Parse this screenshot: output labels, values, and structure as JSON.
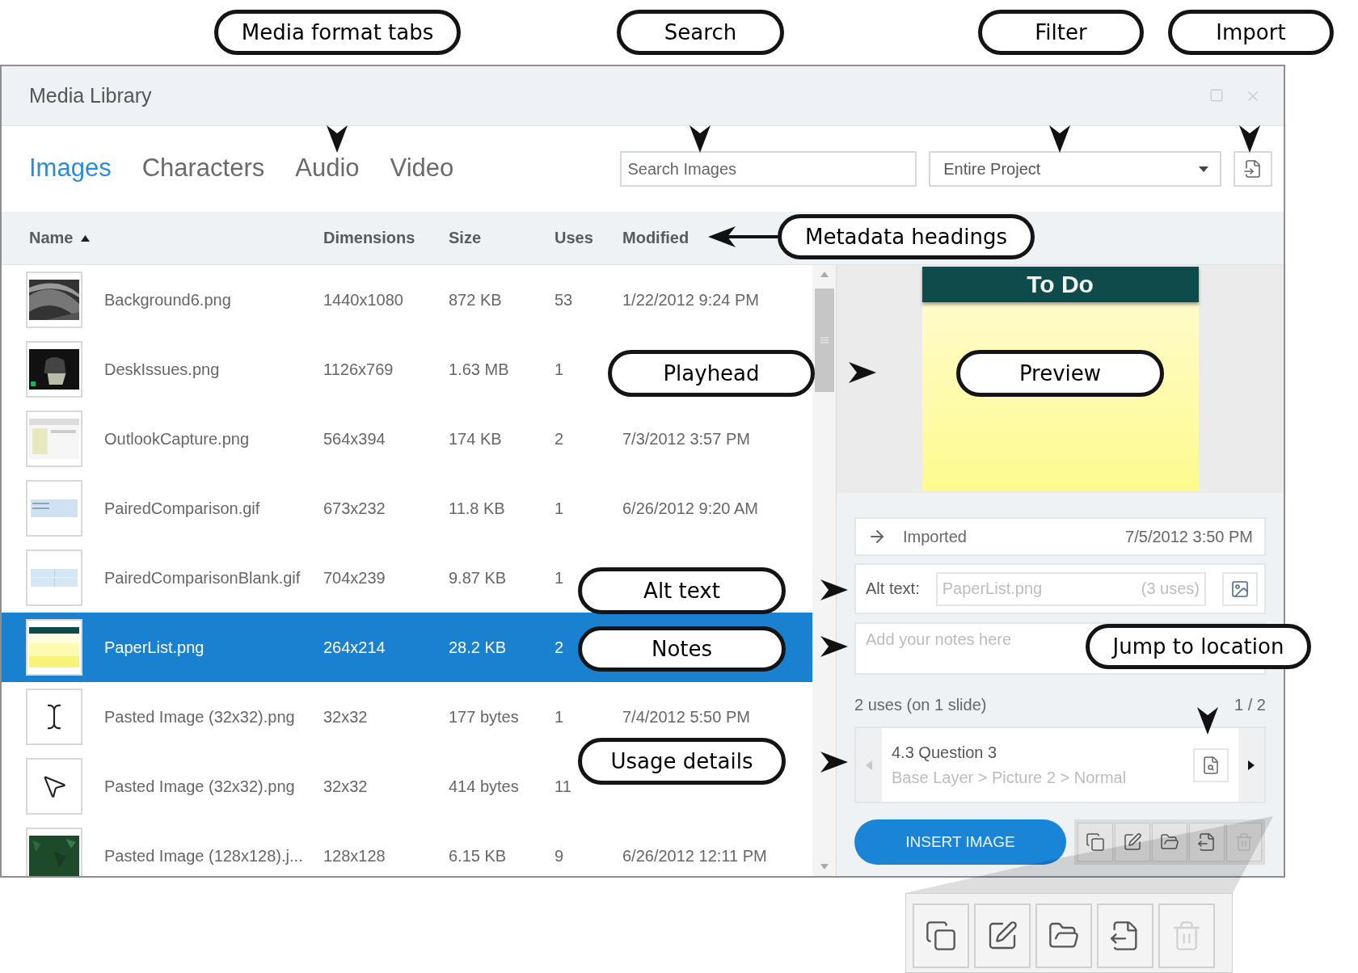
{
  "callouts": [
    {
      "text": "Media format tabs"
    },
    {
      "text": "Search"
    },
    {
      "text": "Filter"
    },
    {
      "text": "Import"
    },
    {
      "text": "Metadata headings"
    },
    {
      "text": "Playhead"
    },
    {
      "text": "Preview"
    },
    {
      "text": "Alt text"
    },
    {
      "text": "Notes"
    },
    {
      "text": "Jump to location"
    },
    {
      "text": "Usage details"
    }
  ],
  "window": {
    "title": "Media Library"
  },
  "tabs": [
    {
      "label": "Images",
      "selected": true
    },
    {
      "label": "Characters",
      "selected": false
    },
    {
      "label": "Audio",
      "selected": false
    },
    {
      "label": "Video",
      "selected": false
    }
  ],
  "search": {
    "placeholder": "Search Images"
  },
  "filter": {
    "value": "Entire Project"
  },
  "table": {
    "columns": [
      {
        "label": "Name",
        "sorted": true
      },
      {
        "label": "Dimensions",
        "sorted": false
      },
      {
        "label": "Size",
        "sorted": false
      },
      {
        "label": "Uses",
        "sorted": false
      },
      {
        "label": "Modified",
        "sorted": false
      }
    ],
    "rows": [
      {
        "kind": "picture",
        "name": "Background6.png",
        "dimensions": "1440x1080",
        "size": "872 KB",
        "uses": "53",
        "modified": "1/22/2012 9:24 PM",
        "selected": false
      },
      {
        "kind": "picture",
        "name": "DeskIssues.png",
        "dimensions": "1126x769",
        "size": "1.63 MB",
        "uses": "1",
        "selected": false
      },
      {
        "kind": "picture",
        "name": "OutlookCapture.png",
        "dimensions": "564x394",
        "size": "174 KB",
        "uses": "2",
        "modified": "7/3/2012 3:57 PM",
        "selected": false
      },
      {
        "kind": "picture",
        "name": "PairedComparison.gif",
        "dimensions": "673x232",
        "size": "11.8 KB",
        "uses": "1",
        "modified": "6/26/2012 9:20 AM",
        "selected": false
      },
      {
        "kind": "picture",
        "name": "PairedComparisonBlank.gif",
        "dimensions": "704x239",
        "size": "9.87 KB",
        "uses": "1",
        "selected": false
      },
      {
        "kind": "picture",
        "name": "PaperList.png",
        "dimensions": "264x214",
        "size": "28.2 KB",
        "uses": "2",
        "selected": true
      },
      {
        "kind": "text-cursor",
        "name": "Pasted Image (32x32).png",
        "dimensions": "32x32",
        "size": "177 bytes",
        "uses": "1",
        "modified": "7/4/2012 5:50 PM",
        "selected": false
      },
      {
        "kind": "pointer",
        "name": "Pasted Image (32x32).png",
        "dimensions": "32x32",
        "size": "414 bytes",
        "uses": "11",
        "selected": false
      },
      {
        "kind": "picture",
        "name": "Pasted Image (128x128).j...",
        "dimensions": "128x128",
        "size": "6.15 KB",
        "uses": "9",
        "modified": "6/26/2012 12:11 PM",
        "selected": false
      }
    ]
  },
  "preview": {
    "title": "To Do"
  },
  "imported": {
    "label": "Imported",
    "date": "7/5/2012 3:50 PM"
  },
  "alt_text": {
    "label": "Alt text:",
    "placeholder": "PaperList.png",
    "uses": "(3 uses)"
  },
  "notes": {
    "placeholder": "Add your notes here"
  },
  "usage": {
    "summary": "2 uses (on 1 slide)",
    "pager": "1 / 2",
    "slide": "4.3 Question 3",
    "path": "Base Layer > Picture 2 > Normal",
    "prev_disabled": true,
    "next_disabled": false
  },
  "insert_button": "INSERT IMAGE",
  "toolbar": [
    {
      "kind": "copy",
      "disabled": false
    },
    {
      "kind": "edit",
      "disabled": false
    },
    {
      "kind": "open",
      "disabled": false
    },
    {
      "kind": "export",
      "disabled": false
    },
    {
      "kind": "delete",
      "disabled": true
    }
  ],
  "magnified_toolbar": [
    {
      "kind": "copy",
      "disabled": false
    },
    {
      "kind": "edit",
      "disabled": false
    },
    {
      "kind": "open",
      "disabled": false
    },
    {
      "kind": "export",
      "disabled": false
    },
    {
      "kind": "delete",
      "disabled": true
    }
  ]
}
